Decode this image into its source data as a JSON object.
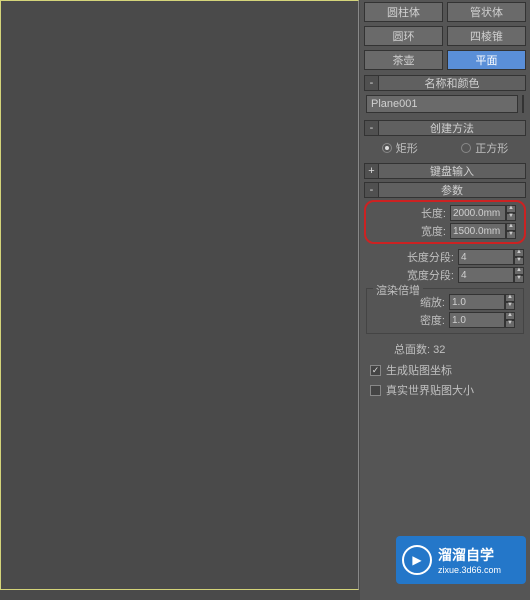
{
  "primitives": {
    "row1": [
      "圆柱体",
      "管状体"
    ],
    "row2": [
      "圆环",
      "四棱锥"
    ],
    "row3": [
      "茶壶",
      "平面"
    ]
  },
  "rollouts": {
    "name_color": {
      "title": "名称和颜色",
      "toggle": "-"
    },
    "creation": {
      "title": "创建方法",
      "toggle": "-"
    },
    "keyboard": {
      "title": "键盘输入",
      "toggle": "+"
    },
    "params": {
      "title": "参数",
      "toggle": "-"
    }
  },
  "name_field": {
    "value": "Plane001"
  },
  "creation": {
    "rect": "矩形",
    "square": "正方形"
  },
  "params": {
    "length_label": "长度:",
    "length_value": "2000.0mm",
    "width_label": "宽度:",
    "width_value": "1500.0mm",
    "lseg_label": "长度分段:",
    "lseg_value": "4",
    "wseg_label": "宽度分段:",
    "wseg_value": "4"
  },
  "render_mult": {
    "legend": "渲染倍增",
    "scale_label": "缩放:",
    "scale_value": "1.0",
    "density_label": "密度:",
    "density_value": "1.0"
  },
  "total_faces": {
    "label": "总面数:",
    "value": "32"
  },
  "checks": {
    "gen_coords": "生成贴图坐标",
    "real_world": "真实世界贴图大小"
  },
  "watermark": {
    "brand": "溜溜自学",
    "sub": "zixue.3d66.com"
  }
}
